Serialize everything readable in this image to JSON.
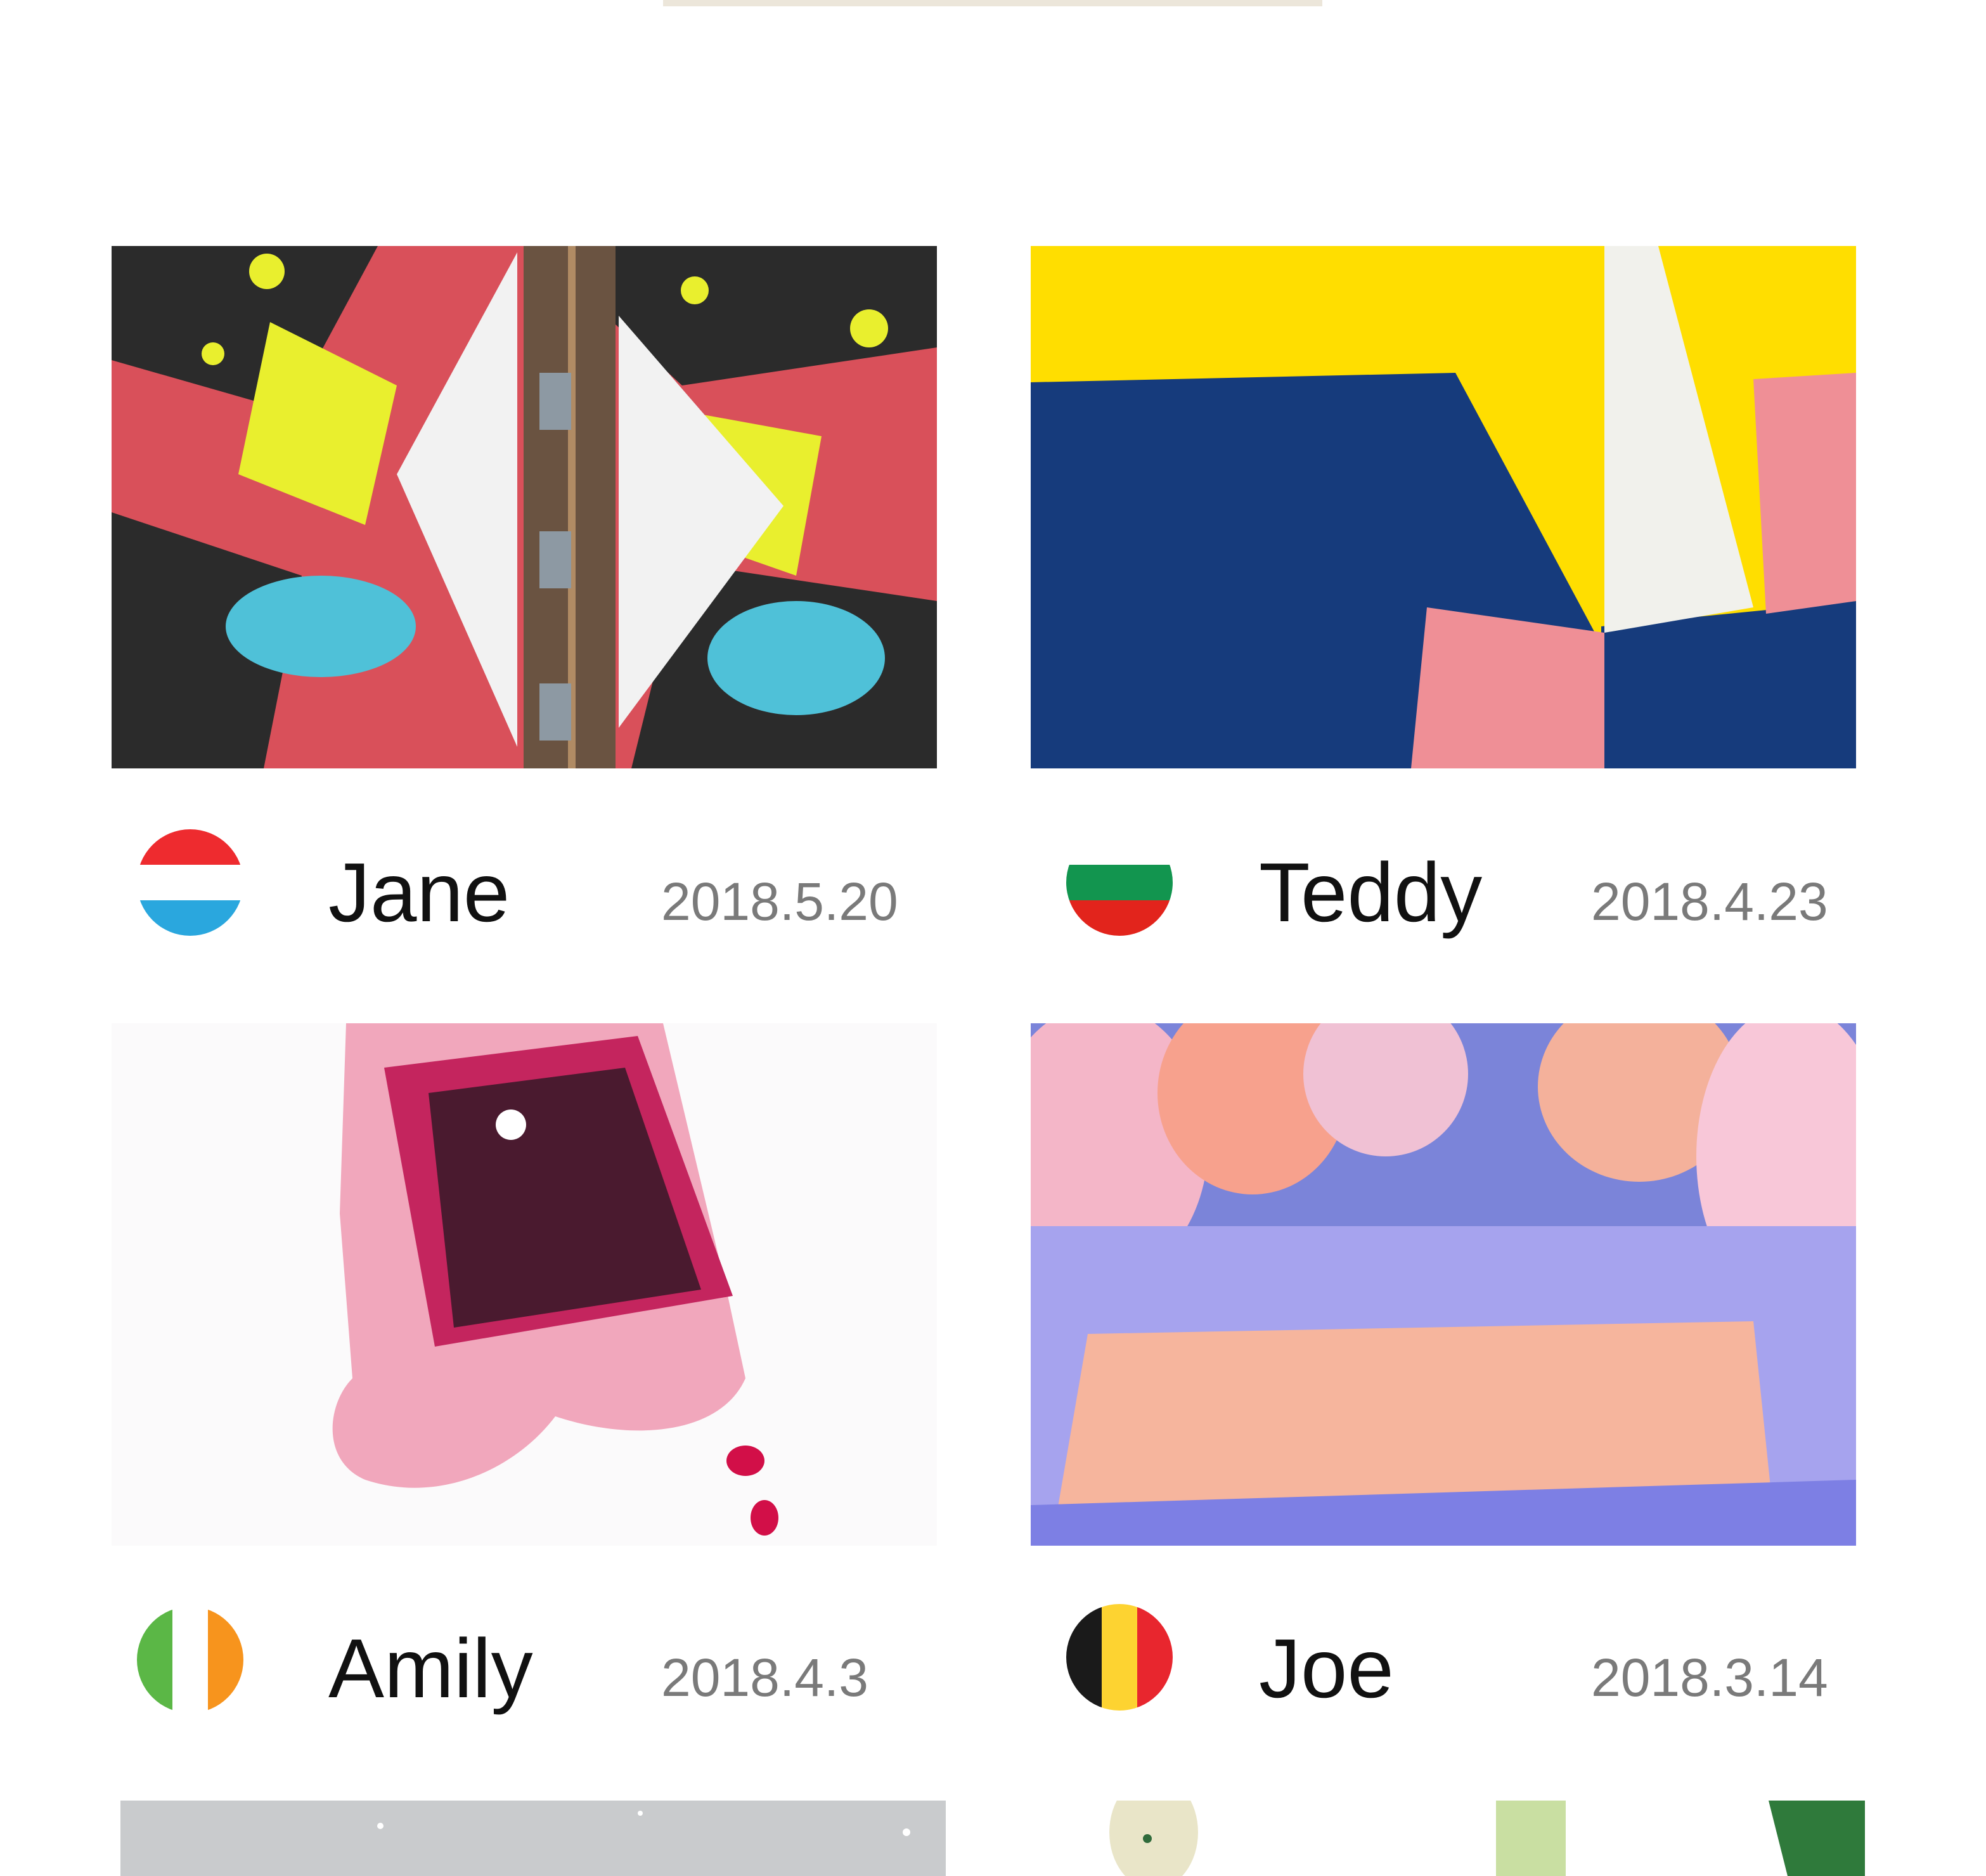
{
  "posts": [
    {
      "name": "Jane",
      "date": "2018.5.20",
      "flag_icon": "luxembourg-flag-icon",
      "flag_colors": [
        "#ee2b2f",
        "#ffffff",
        "#2aa7de"
      ],
      "image": "street-art-mural-image"
    },
    {
      "name": "Teddy",
      "date": "2018.4.23",
      "flag_icon": "bulgaria-flag-icon",
      "flag_colors": [
        "#ffffff",
        "#12954f",
        "#e2241c"
      ],
      "image": "abstract-painted-wall-image"
    },
    {
      "name": "Amily",
      "date": "2018.4.3",
      "flag_icon": "ireland-flag-icon",
      "flag_colors": [
        "#5bb746",
        "#ffffff",
        "#f7941d"
      ],
      "image": "tea-bag-stain-image"
    },
    {
      "name": "Joe",
      "date": "2018.3.14",
      "flag_icon": "belgium-flag-icon",
      "flag_colors": [
        "#1a1a1a",
        "#fdd331",
        "#e8262e"
      ],
      "image": "snowy-forest-sunset-image"
    }
  ],
  "partial_row": [
    {
      "image": "snowy-scene-image"
    },
    {
      "image": "cactus-illustration-image"
    }
  ],
  "colors": {
    "name_text": "#111111",
    "date_text": "#7a7a7a",
    "top_tab": "#ece6da"
  }
}
